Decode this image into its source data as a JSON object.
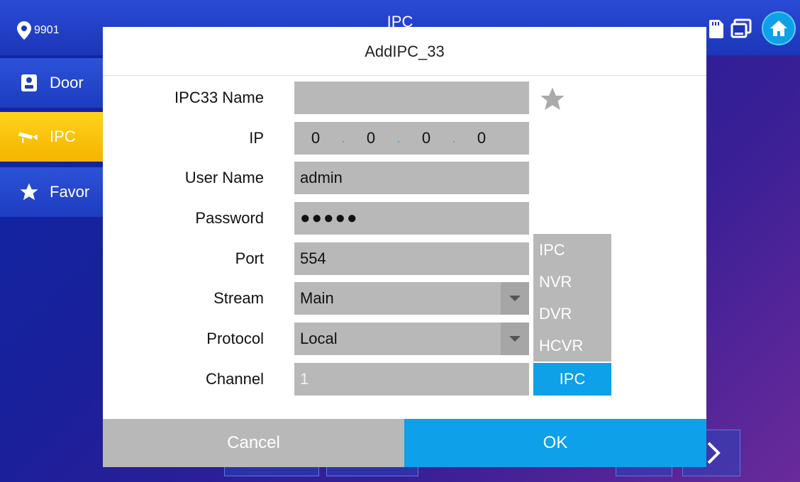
{
  "header": {
    "location": "9901",
    "title": "IPC"
  },
  "sidebar": {
    "items": [
      {
        "label": "Door",
        "icon": "intercom-icon"
      },
      {
        "label": "IPC",
        "icon": "camera-icon",
        "active": true
      },
      {
        "label": "Favor",
        "icon": "star-icon"
      }
    ]
  },
  "dialog": {
    "title": "AddIPC_33",
    "fields": {
      "name": {
        "label": "IPC33 Name",
        "value": ""
      },
      "ip": {
        "label": "IP",
        "segments": [
          "0",
          "0",
          "0",
          "0"
        ],
        "separator": "."
      },
      "username": {
        "label": "User Name",
        "value": "admin"
      },
      "password": {
        "label": "Password",
        "value": "●●●●●"
      },
      "port": {
        "label": "Port",
        "value": "554"
      },
      "stream": {
        "label": "Stream",
        "value": "Main"
      },
      "protocol": {
        "label": "Protocol",
        "value": "Local"
      },
      "channel": {
        "label": "Channel",
        "value": "1"
      }
    },
    "device_types": [
      "IPC",
      "NVR",
      "DVR",
      "HCVR"
    ],
    "selected_type": "IPC",
    "cancel_label": "Cancel",
    "ok_label": "OK"
  },
  "colors": {
    "accent": "#0ea0e8",
    "active_menu": "#f5b400",
    "field_bg": "#b8b8b8"
  }
}
